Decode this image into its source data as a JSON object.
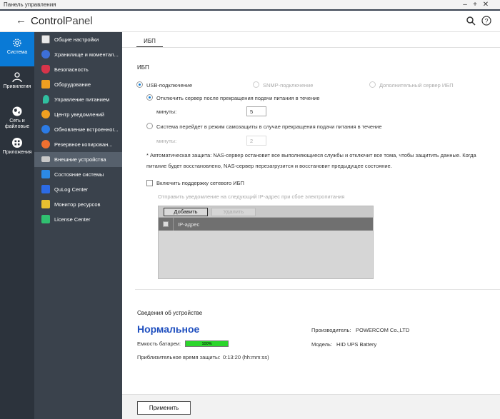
{
  "window": {
    "title": "Панель управления"
  },
  "header": {
    "app_name_bold": "Control",
    "app_name_light": "Panel"
  },
  "rail": {
    "items": [
      {
        "label": "Система",
        "icon": "gear-icon",
        "active": true
      },
      {
        "label": "Привилегия",
        "icon": "user-icon",
        "active": false
      },
      {
        "label": "Сеть и файловые",
        "icon": "globe-icon",
        "active": false
      },
      {
        "label": "Приложения",
        "icon": "apps-icon",
        "active": false
      }
    ]
  },
  "sidebar": {
    "items": [
      {
        "label": "Общие настройки",
        "icon": "settings-doc-icon",
        "color": "#e9e9e9",
        "active": false
      },
      {
        "label": "Хранилище и моментал...",
        "icon": "storage-icon",
        "color": "#3d6fd8",
        "active": false
      },
      {
        "label": "Безопасность",
        "icon": "security-icon",
        "color": "#d7344a",
        "active": false
      },
      {
        "label": "Оборудование",
        "icon": "hardware-icon",
        "color": "#f0a020",
        "active": false
      },
      {
        "label": "Управление питанием",
        "icon": "power-icon",
        "color": "#30c0a0",
        "active": false
      },
      {
        "label": "Центр уведомлений",
        "icon": "notification-icon",
        "color": "#f0a020",
        "active": false
      },
      {
        "label": "Обновление встроенног...",
        "icon": "firmware-icon",
        "color": "#2c7be5",
        "active": false
      },
      {
        "label": "Резервное копирован...",
        "icon": "backup-icon",
        "color": "#f07030",
        "active": false
      },
      {
        "label": "Внешние устройства",
        "icon": "external-device-icon",
        "color": "#c8c8c8",
        "active": true
      },
      {
        "label": "Состояние системы",
        "icon": "system-status-icon",
        "color": "#2c8ae5",
        "active": false
      },
      {
        "label": "QuLog Center",
        "icon": "qulog-icon",
        "color": "#2c6be5",
        "active": false
      },
      {
        "label": "Монитор ресурсов",
        "icon": "resource-monitor-icon",
        "color": "#e8c030",
        "active": false
      },
      {
        "label": "License Center",
        "icon": "license-icon",
        "color": "#30c070",
        "active": false
      }
    ]
  },
  "tab": {
    "label": "ИБП"
  },
  "ups": {
    "section_title": "ИБП",
    "mode_usb": "USB-подключение",
    "mode_snmp": "SNMP-подключение",
    "mode_server": "Дополнительный сервер ИБП",
    "opt_shutdown": "Отключить сервер после прекращения подачи питания в течение",
    "minutes_label": "минуты:",
    "minutes_value": "5",
    "opt_protect": "Система перейдет в режим самозащиты в случае прекращения подачи питания в течение",
    "minutes_label2": "минуты:",
    "minutes_value2": "2",
    "note_line1": "* Автоматическая защита: NAS-сервер остановит все выполняющиеся службы и отключит все тома, чтобы защитить данные. Когда",
    "note_line2": "питание будет восстановлено, NAS-сервер перезагрузится и восстановит предыдущее состояние.",
    "network_ups_label": "Включить поддержку сетевого ИБП",
    "notify_hint": "Отправить уведомление на следующий IP-адрес при сбое электропитания",
    "add_button": "Добавить",
    "delete_button": "Удалить",
    "col_ip": "IP-адрес"
  },
  "device": {
    "title": "Сведения об устройстве",
    "status": "Нормальное",
    "battery_label": "Емкость батареи:",
    "battery_value": "100%",
    "battery_percent": 100,
    "protect_time_label": "Приблизительное время защиты:",
    "protect_time_value": "0:13:20 (hh:mm:ss)",
    "manufacturer_label": "Производитель:",
    "manufacturer_value": "POWERCOM Co.,LTD",
    "model_label": "Модель:",
    "model_value": "HID UPS Battery"
  },
  "footer": {
    "apply_button": "Применить"
  }
}
